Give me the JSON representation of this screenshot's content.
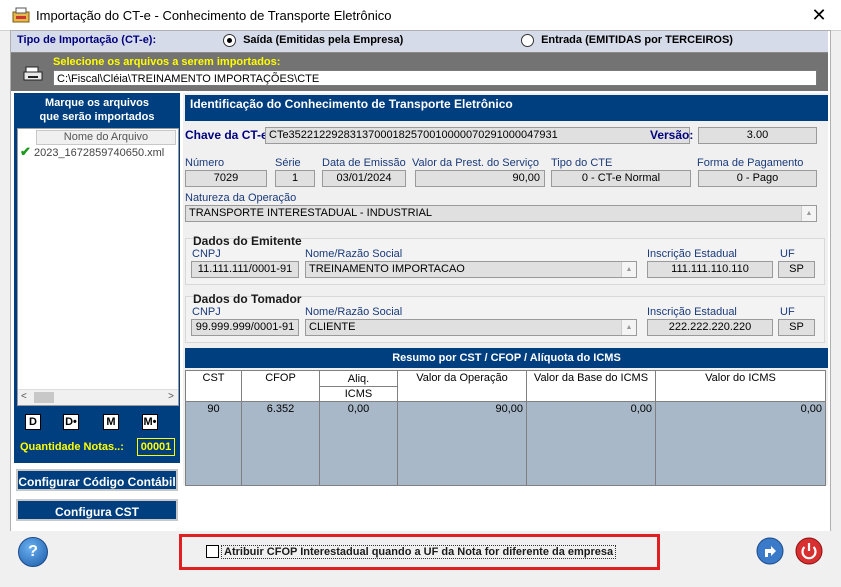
{
  "window": {
    "title": "Importação do CT-e - Conhecimento de Transporte Eletrônico",
    "close_symbol": "✕"
  },
  "import_type": {
    "label": "Tipo de Importação (CT-e):",
    "options": [
      {
        "label": "Saída (Emitidas pela Empresa)",
        "selected": true
      },
      {
        "label": "Entrada (EMITIDAS por TERCEIROS)",
        "selected": false
      }
    ]
  },
  "file_select": {
    "label": "Selecione os arquivos a serem importados:",
    "path": "C:\\Fiscal\\Cléia\\TREINAMENTO IMPORTAÇÕES\\CTE"
  },
  "file_panel": {
    "title_line1": "Marque os arquivos",
    "title_line2": "que serão importados",
    "column_header": "Nome do Arquivo",
    "files": [
      {
        "name": "2023_1672859740650.xml",
        "checked": true
      }
    ],
    "mini_buttons": [
      "D",
      "D•",
      "M",
      "M•"
    ],
    "count_label": "Quantidade Notas..:",
    "count_value": "00001"
  },
  "buttons": {
    "configure_account": "Configurar Código Contábil",
    "configure_cst": "Configura CST"
  },
  "identification": {
    "section_title": "Identificação do Conhecimento de Transporte Eletrônico",
    "key_label": "Chave da CT-e",
    "key_value": "CTe35221229283137000182570010000070291000047931",
    "version_label": "Versão:",
    "version_value": "3.00",
    "number_label": "Número",
    "number_value": "7029",
    "series_label": "Série",
    "series_value": "1",
    "issue_date_label": "Data de Emissão",
    "issue_date_value": "03/01/2024",
    "service_value_label": "Valor da Prest. do Serviço",
    "service_value": "90,00",
    "cte_type_label": "Tipo do CTE",
    "cte_type_value": "0 - CT-e Normal",
    "payment_label": "Forma de Pagamento",
    "payment_value": "0 - Pago",
    "nature_label": "Natureza da Operação",
    "nature_value": "TRANSPORTE INTERESTADUAL - INDUSTRIAL"
  },
  "emitter": {
    "title": "Dados do Emitente",
    "cnpj_label": "CNPJ",
    "cnpj_value": "11.111.111/0001-91",
    "name_label": "Nome/Razão Social",
    "name_value": "TREINAMENTO IMPORTACAO",
    "ie_label": "Inscrição Estadual",
    "ie_value": "111.111.110.110",
    "uf_label": "UF",
    "uf_value": "SP"
  },
  "taker": {
    "title": "Dados do Tomador",
    "cnpj_label": "CNPJ",
    "cnpj_value": "99.999.999/0001-91",
    "name_label": "Nome/Razão Social",
    "name_value": "CLIENTE",
    "ie_label": "Inscrição Estadual",
    "ie_value": "222.222.220.220",
    "uf_label": "UF",
    "uf_value": "SP"
  },
  "summary": {
    "title": "Resumo  por  CST  /  CFOP  /  Alíquota do ICMS",
    "headers": {
      "cst": "CST",
      "cfop": "CFOP",
      "aliq_top": "Aliq.",
      "aliq_bottom": "ICMS",
      "op_value": "Valor da Operação",
      "base_value": "Valor da Base do ICMS",
      "icms_value": "Valor do ICMS"
    },
    "rows": [
      {
        "cst": "90",
        "cfop": "6.352",
        "aliq": "0,00",
        "op_value": "90,00",
        "base_value": "0,00",
        "icms_value": "0,00"
      }
    ]
  },
  "footer": {
    "checkbox_label": "Atribuir CFOP Interestadual quando a UF da Nota for diferente da empresa",
    "checkbox_checked": false,
    "help_symbol": "?",
    "highlight_color": "#e02020"
  },
  "colors": {
    "navy": "#003f7f",
    "yellow": "#ffff00"
  }
}
